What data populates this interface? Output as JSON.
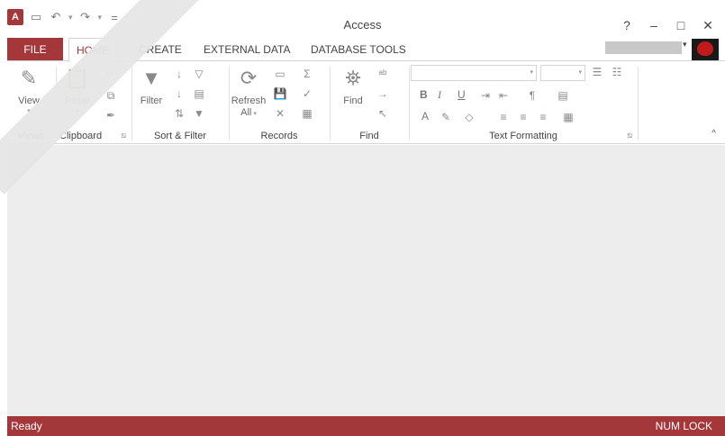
{
  "app": {
    "title": "Access",
    "logo_text": "A",
    "accent_color": "#a4373a"
  },
  "quick_access": {
    "icons": [
      "save-icon",
      "undo-icon",
      "redo-icon",
      "customize-icon"
    ],
    "undo_glyph": "↶",
    "redo_glyph": "↷",
    "save_glyph": "▭",
    "customize_glyph": "="
  },
  "window_buttons": {
    "help": "?",
    "minimize": "–",
    "maximize": "□",
    "close": "✕"
  },
  "tabs": {
    "file": "FILE",
    "items": [
      "HOME",
      "CREATE",
      "EXTERNAL DATA",
      "DATABASE TOOLS"
    ],
    "active": "HOME"
  },
  "ribbon": {
    "groups": {
      "views": {
        "label": "Views",
        "view_button": "View"
      },
      "clipboard": {
        "label": "Clipboard",
        "paste_button": "Paste"
      },
      "sort_filter": {
        "label": "Sort & Filter",
        "filter_button": "Filter"
      },
      "records": {
        "label": "Records",
        "refresh_button": "Refresh",
        "refresh_sub": "All"
      },
      "find": {
        "label": "Find",
        "find_button": "Find"
      },
      "text_formatting": {
        "label": "Text Formatting",
        "bold": "B",
        "italic": "I",
        "underline": "U",
        "font_color": "A",
        "font_name_value": "",
        "font_size_value": ""
      }
    }
  },
  "status": {
    "left": "Ready",
    "right": "NUM LOCK"
  }
}
